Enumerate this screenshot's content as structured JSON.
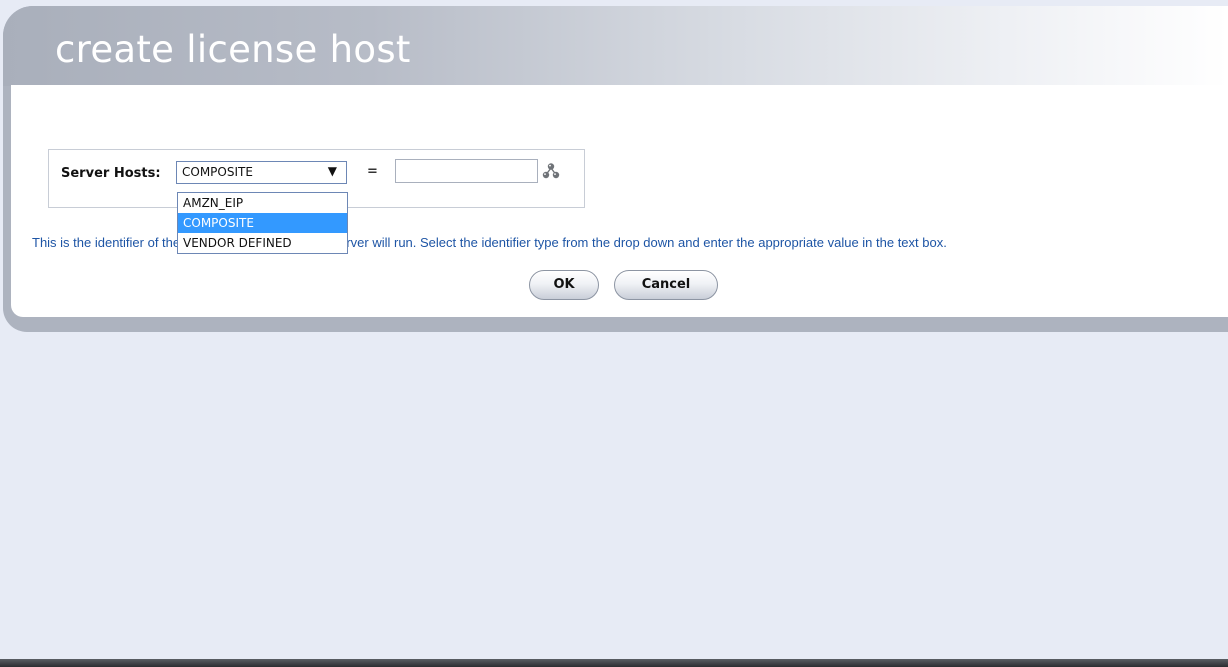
{
  "dialog": {
    "title": "create license host"
  },
  "form": {
    "server_hosts_label": "Server Hosts:",
    "selected_type": "COMPOSITE",
    "equals_sign": "=",
    "value": "",
    "lookup_icon": "hierarchy-lookup-icon"
  },
  "dropdown": {
    "options": [
      "AMZN_EIP",
      "COMPOSITE",
      "VENDOR DEFINED"
    ],
    "highlighted": "COMPOSITE"
  },
  "help_text": "This is the identifier of the host on which the license server will run. Select the identifier type from the drop down and enter the appropriate value in the text box.",
  "buttons": {
    "ok_label": "OK",
    "cancel_label": "Cancel"
  },
  "colors": {
    "help_text": "#1e55a5",
    "highlight": "#3399ff",
    "page_background": "#e7ebf5"
  }
}
